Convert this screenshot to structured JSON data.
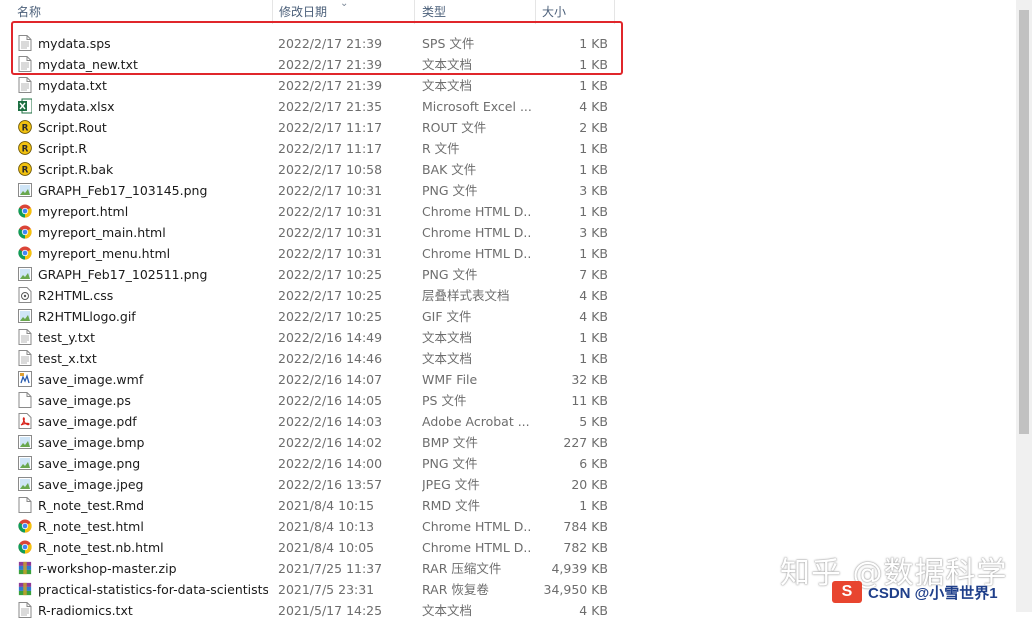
{
  "columns": {
    "name": "名称",
    "date": "修改日期",
    "type": "类型",
    "size": "大小"
  },
  "files": [
    {
      "icon": "text-file-icon",
      "name": "mydata.sps",
      "date": "2022/2/17 21:39",
      "type": "SPS 文件",
      "size": "1 KB"
    },
    {
      "icon": "text-file-icon",
      "name": "mydata_new.txt",
      "date": "2022/2/17 21:39",
      "type": "文本文档",
      "size": "1 KB"
    },
    {
      "icon": "text-file-icon",
      "name": "mydata.txt",
      "date": "2022/2/17 21:39",
      "type": "文本文档",
      "size": "1 KB"
    },
    {
      "icon": "excel-file-icon",
      "name": "mydata.xlsx",
      "date": "2022/2/17 21:35",
      "type": "Microsoft Excel ...",
      "size": "4 KB"
    },
    {
      "icon": "r-file-icon",
      "name": "Script.Rout",
      "date": "2022/2/17 11:17",
      "type": "ROUT 文件",
      "size": "2 KB"
    },
    {
      "icon": "r-file-icon",
      "name": "Script.R",
      "date": "2022/2/17 11:17",
      "type": "R 文件",
      "size": "1 KB"
    },
    {
      "icon": "r-file-icon",
      "name": "Script.R.bak",
      "date": "2022/2/17 10:58",
      "type": "BAK 文件",
      "size": "1 KB"
    },
    {
      "icon": "image-file-icon",
      "name": "GRAPH_Feb17_103145.png",
      "date": "2022/2/17 10:31",
      "type": "PNG 文件",
      "size": "3 KB"
    },
    {
      "icon": "chrome-file-icon",
      "name": "myreport.html",
      "date": "2022/2/17 10:31",
      "type": "Chrome HTML D...",
      "size": "1 KB"
    },
    {
      "icon": "chrome-file-icon",
      "name": "myreport_main.html",
      "date": "2022/2/17 10:31",
      "type": "Chrome HTML D...",
      "size": "3 KB"
    },
    {
      "icon": "chrome-file-icon",
      "name": "myreport_menu.html",
      "date": "2022/2/17 10:31",
      "type": "Chrome HTML D...",
      "size": "1 KB"
    },
    {
      "icon": "image-file-icon",
      "name": "GRAPH_Feb17_102511.png",
      "date": "2022/2/17 10:25",
      "type": "PNG 文件",
      "size": "7 KB"
    },
    {
      "icon": "css-file-icon",
      "name": "R2HTML.css",
      "date": "2022/2/17 10:25",
      "type": "层叠样式表文档",
      "size": "4 KB"
    },
    {
      "icon": "image-file-icon",
      "name": "R2HTMLlogo.gif",
      "date": "2022/2/17 10:25",
      "type": "GIF 文件",
      "size": "4 KB"
    },
    {
      "icon": "text-file-icon",
      "name": "test_y.txt",
      "date": "2022/2/16 14:49",
      "type": "文本文档",
      "size": "1 KB"
    },
    {
      "icon": "text-file-icon",
      "name": "test_x.txt",
      "date": "2022/2/16 14:46",
      "type": "文本文档",
      "size": "1 KB"
    },
    {
      "icon": "wmf-file-icon",
      "name": "save_image.wmf",
      "date": "2022/2/16 14:07",
      "type": "WMF File",
      "size": "32 KB"
    },
    {
      "icon": "blank-file-icon",
      "name": "save_image.ps",
      "date": "2022/2/16 14:05",
      "type": "PS 文件",
      "size": "11 KB"
    },
    {
      "icon": "pdf-file-icon",
      "name": "save_image.pdf",
      "date": "2022/2/16 14:03",
      "type": "Adobe Acrobat ...",
      "size": "5 KB"
    },
    {
      "icon": "image-file-icon",
      "name": "save_image.bmp",
      "date": "2022/2/16 14:02",
      "type": "BMP 文件",
      "size": "227 KB"
    },
    {
      "icon": "image-file-icon",
      "name": "save_image.png",
      "date": "2022/2/16 14:00",
      "type": "PNG 文件",
      "size": "6 KB"
    },
    {
      "icon": "image-file-icon",
      "name": "save_image.jpeg",
      "date": "2022/2/16 13:57",
      "type": "JPEG 文件",
      "size": "20 KB"
    },
    {
      "icon": "blank-file-icon",
      "name": "R_note_test.Rmd",
      "date": "2021/8/4 10:15",
      "type": "RMD 文件",
      "size": "1 KB"
    },
    {
      "icon": "chrome-file-icon",
      "name": "R_note_test.html",
      "date": "2021/8/4 10:13",
      "type": "Chrome HTML D...",
      "size": "784 KB"
    },
    {
      "icon": "chrome-file-icon",
      "name": "R_note_test.nb.html",
      "date": "2021/8/4 10:05",
      "type": "Chrome HTML D...",
      "size": "782 KB"
    },
    {
      "icon": "rar-file-icon",
      "name": "r-workshop-master.zip",
      "date": "2021/7/25 11:37",
      "type": "RAR 压缩文件",
      "size": "4,939 KB"
    },
    {
      "icon": "rar-file-icon",
      "name": "practical-statistics-for-data-scientists...",
      "date": "2021/7/5 23:31",
      "type": "RAR 恢复卷",
      "size": "34,950 KB"
    },
    {
      "icon": "text-file-icon",
      "name": "R-radiomics.txt",
      "date": "2021/5/17 14:25",
      "type": "文本文档",
      "size": "4 KB"
    }
  ],
  "watermark": {
    "zhihu": "知乎 @数据科学",
    "csdn_logo": "S",
    "csdn_text": "CSDN @小雪世界1"
  },
  "colors": {
    "highlight_border": "#e0262b",
    "header_text": "#4c607a"
  }
}
